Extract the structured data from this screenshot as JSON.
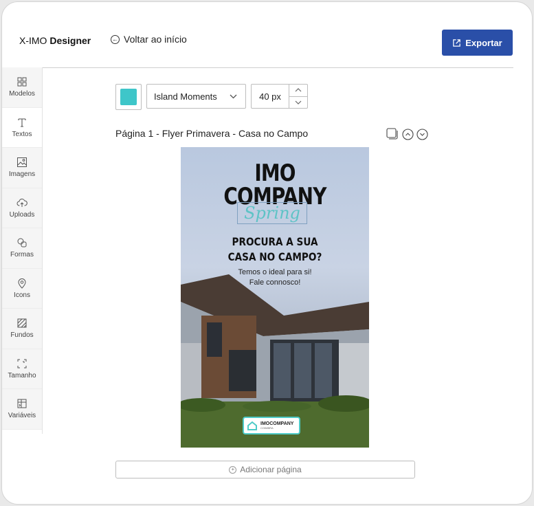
{
  "app": {
    "brand_prefix": "X-IMO",
    "brand_bold": "Designer",
    "back_label": "Voltar ao início",
    "export_label": "Exportar",
    "accent_color": "#2a4fa8"
  },
  "sidebar": {
    "items": [
      {
        "label": "Modelos",
        "icon": "grid-icon"
      },
      {
        "label": "Textos",
        "icon": "text-icon"
      },
      {
        "label": "Imagens",
        "icon": "image-icon"
      },
      {
        "label": "Uploads",
        "icon": "cloud-upload-icon"
      },
      {
        "label": "Formas",
        "icon": "shapes-icon"
      },
      {
        "label": "Icons",
        "icon": "map-pin-icon"
      },
      {
        "label": "Fundos",
        "icon": "hatch-background-icon"
      },
      {
        "label": "Tamanho",
        "icon": "resize-icon"
      },
      {
        "label": "Variáveis",
        "icon": "table-variables-icon"
      }
    ],
    "active_index": 1
  },
  "toolbar": {
    "text_color": "#3ec6c9",
    "font_family_value": "Island Moments",
    "font_size_value": "40 px"
  },
  "page": {
    "title": "Página 1 - Flyer Primavera - Casa no Campo",
    "add_page_label": "Adicionar página"
  },
  "flyer": {
    "title_line1": "IMO",
    "title_line2": "COMPANY",
    "script_text": "Spring",
    "headline_line1": "PROCURA A SUA",
    "headline_line2": "CASA NO CAMPO?",
    "sub_line1": "Temos o ideal para si!",
    "sub_line2": "Fale connosco!",
    "logo_text": "IMOCOMPANY",
    "logo_subtext": "COIMBRA",
    "accent_color": "#4ecbc8"
  }
}
